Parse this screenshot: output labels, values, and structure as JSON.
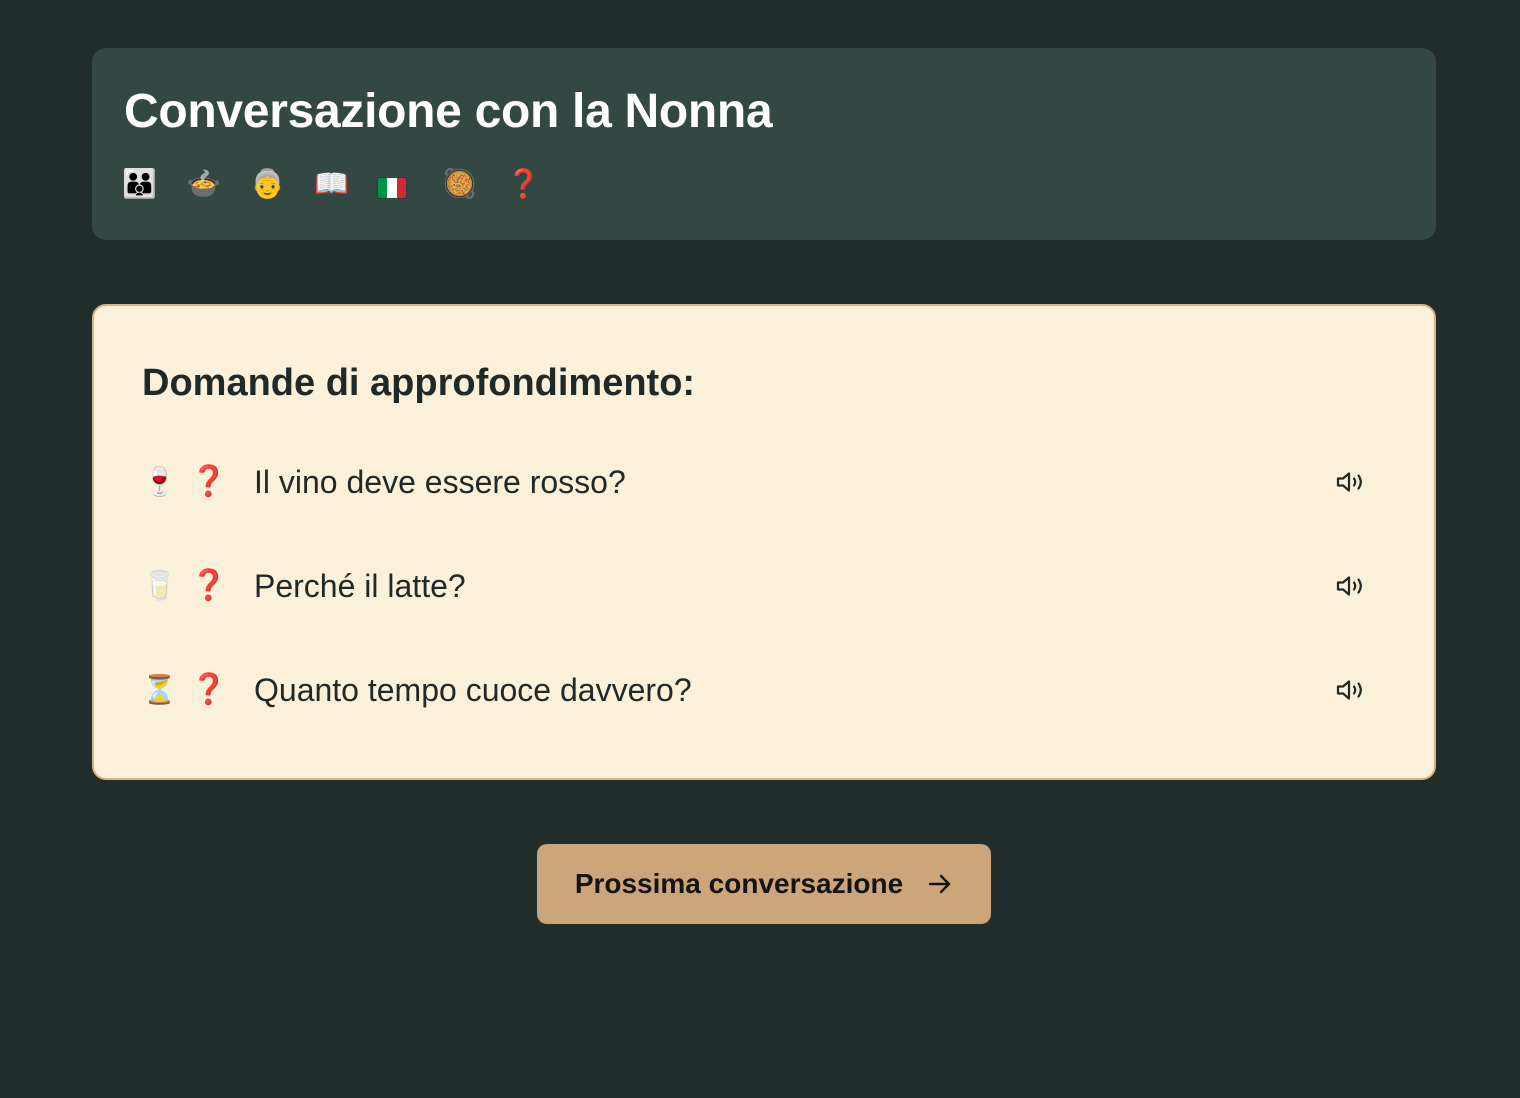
{
  "header": {
    "title": "Conversazione con la Nonna",
    "icons": [
      {
        "name": "family-icon",
        "glyph": "👪"
      },
      {
        "name": "soup-bowl-icon",
        "glyph": "🍲"
      },
      {
        "name": "grandmother-icon",
        "glyph": "👵"
      },
      {
        "name": "open-book-icon",
        "glyph": "📖"
      },
      {
        "name": "italy-flag-icon",
        "glyph": "🇮🇹"
      },
      {
        "name": "pan-icon",
        "glyph": "🥘"
      },
      {
        "name": "question-mark-icon",
        "glyph": "❓"
      }
    ]
  },
  "questions": {
    "title": "Domande di approfondimento:",
    "items": [
      {
        "icon_name": "wine-glass-icon",
        "icon": "🍷",
        "mark": "❓",
        "text": "Il vino deve essere rosso?"
      },
      {
        "icon_name": "milk-glass-icon",
        "icon": "🥛",
        "mark": "❓",
        "text": "Perché il latte?"
      },
      {
        "icon_name": "hourglass-icon",
        "icon": "⏳",
        "mark": "❓",
        "text": "Quanto tempo cuoce davvero?"
      }
    ]
  },
  "footer": {
    "next_label": "Prossima conversazione"
  },
  "colors": {
    "background": "#212d2a",
    "header_card": "#334743",
    "questions_card": "#fbf0d9",
    "questions_border": "#d6b587",
    "button": "#cda57a",
    "question_mark": "#c62828"
  }
}
